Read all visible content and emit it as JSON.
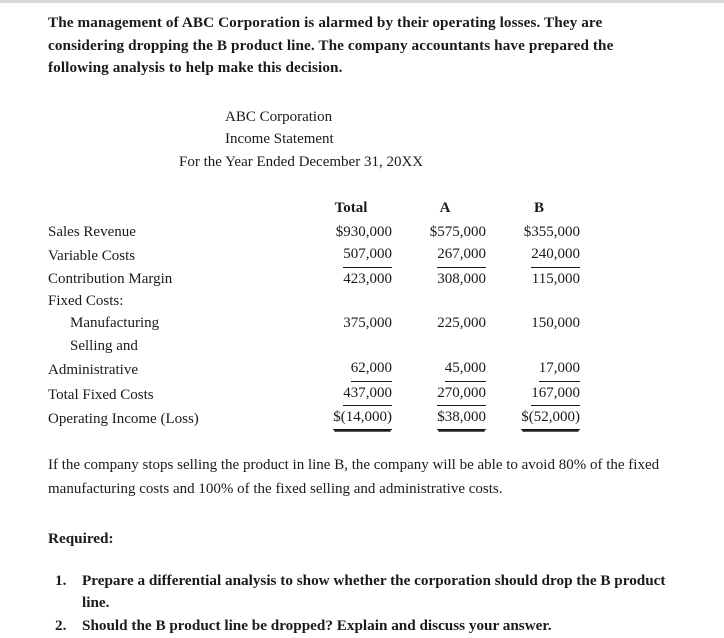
{
  "document": {
    "intro_paragraph": "The management of ABC Corporation is alarmed by their operating losses.  They are considering dropping the B product line.  The company accountants have prepared the following analysis to help make this decision.",
    "statement_header": {
      "line1": "ABC Corporation",
      "line2": "Income Statement",
      "line3": "For the Year Ended December 31, 20XX"
    },
    "income_statement": {
      "columns": [
        "",
        "Total",
        "A",
        "B"
      ],
      "rows": [
        {
          "label": "Sales Revenue",
          "indent": 0,
          "underline": "none",
          "values": [
            "$930,000",
            "$575,000",
            "$355,000"
          ]
        },
        {
          "label": "Variable Costs",
          "indent": 0,
          "underline": "single",
          "values": [
            "507,000",
            "267,000",
            "240,000"
          ]
        },
        {
          "label": "Contribution Margin",
          "indent": 0,
          "underline": "none",
          "values": [
            "423,000",
            "308,000",
            "115,000"
          ]
        },
        {
          "label": "Fixed Costs:",
          "indent": 0,
          "underline": "none",
          "values": [
            "",
            "",
            ""
          ]
        },
        {
          "label": "Manufacturing",
          "indent": 1,
          "underline": "none",
          "values": [
            "375,000",
            "225,000",
            "150,000"
          ]
        },
        {
          "label": "Selling and",
          "indent": 1,
          "underline": "none",
          "values": [
            "",
            "",
            ""
          ]
        },
        {
          "label": "Administrative",
          "indent": 0,
          "underline": "single",
          "values": [
            "62,000",
            "45,000",
            "17,000"
          ]
        },
        {
          "label": "Total Fixed Costs",
          "indent": 0,
          "underline": "single",
          "values": [
            "437,000",
            "270,000",
            "167,000"
          ]
        },
        {
          "label": "Operating Income (Loss)",
          "indent": 0,
          "underline": "double",
          "values": [
            "$(14,000)",
            "$38,000",
            "$(52,000)"
          ]
        }
      ]
    },
    "body_paragraph": "If the company stops selling the product in line B, the company will be able to avoid 80% of the fixed manufacturing costs and 100% of the fixed selling and administrative costs.",
    "required_heading": "Required:",
    "required_items": [
      {
        "number": "1.",
        "text": "Prepare a differential analysis to show whether the corporation should drop the B product line."
      },
      {
        "number": "2.",
        "text": "Should the B product line be dropped? Explain and discuss your answer."
      }
    ]
  }
}
